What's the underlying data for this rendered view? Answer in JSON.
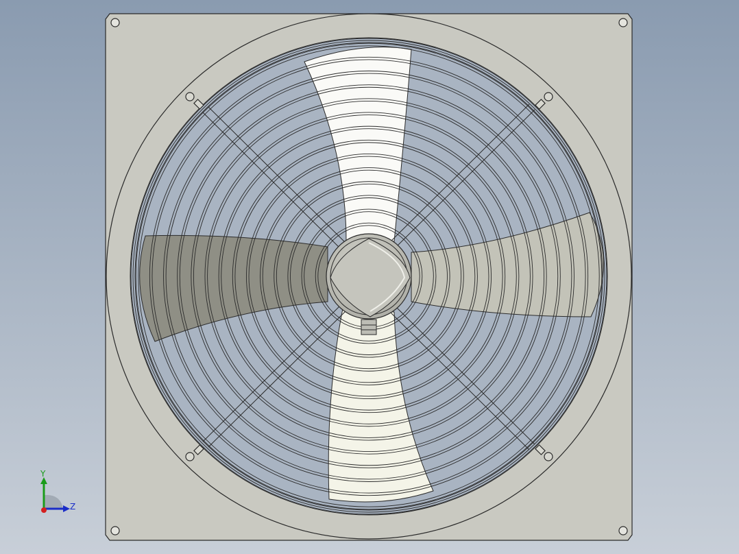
{
  "viewport": {
    "background_top": "#8a9bb0",
    "background_bottom": "#c8cfd8"
  },
  "model": {
    "name": "axial-fan-with-guard",
    "plate_color": "#c9c9c1",
    "edge_color": "#2a2a2a",
    "blade_colors": [
      "#fafaf7",
      "#c3c3b8",
      "#8f8f85",
      "#f4f4e8"
    ],
    "hub_color": "#c5c5bd",
    "guard_rings": 14,
    "guard_spokes": 4,
    "blades": 4,
    "corner_holes": 4
  },
  "triad": {
    "y_label": "Y",
    "z_label": "Z",
    "colors": {
      "x": "#d42020",
      "y": "#1a9c1a",
      "z": "#1a2dc8"
    }
  }
}
